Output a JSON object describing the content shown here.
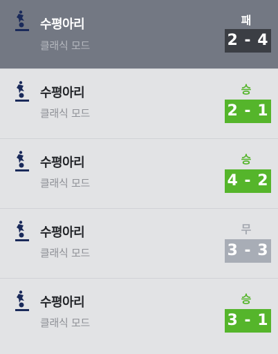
{
  "matches": [
    {
      "team": "수평아리",
      "mode": "클래식 모드",
      "result": "패",
      "score": "2 - 4",
      "outcome": "loss"
    },
    {
      "team": "수평아리",
      "mode": "클래식 모드",
      "result": "승",
      "score": "2 - 1",
      "outcome": "win"
    },
    {
      "team": "수평아리",
      "mode": "클래식 모드",
      "result": "승",
      "score": "4 - 2",
      "outcome": "win"
    },
    {
      "team": "수평아리",
      "mode": "클래식 모드",
      "result": "무",
      "score": "3 - 3",
      "outcome": "draw"
    },
    {
      "team": "수평아리",
      "mode": "클래식 모드",
      "result": "승",
      "score": "3 - 1",
      "outcome": "win"
    }
  ],
  "colors": {
    "win": "#55b52b",
    "draw": "#a8adb6",
    "loss": "#3b3e44",
    "active_row": "#737883",
    "row_bg": "#e2e3e5"
  },
  "icons": {
    "crest": "club-crest-icon"
  }
}
